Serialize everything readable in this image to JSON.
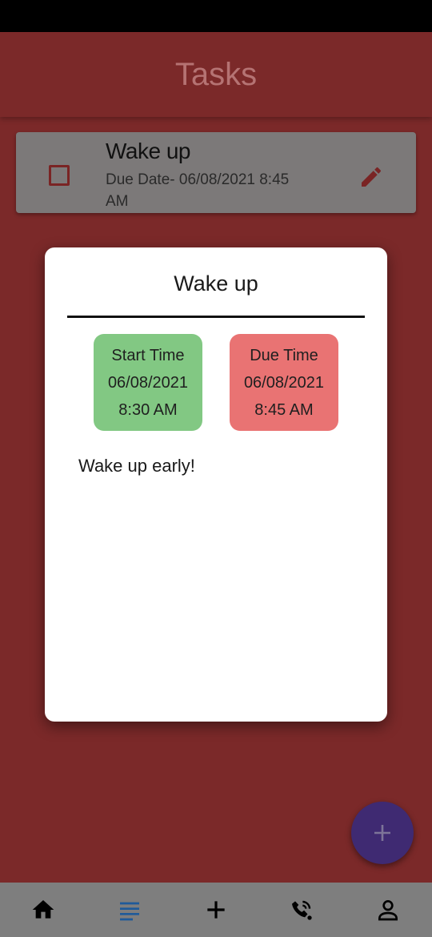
{
  "header": {
    "title": "Tasks"
  },
  "task_list": [
    {
      "title": "Wake up",
      "due_text": "Due Date- 06/08/2021 8:45 AM",
      "checked": false
    }
  ],
  "modal": {
    "title": "Wake up",
    "start": {
      "label": "Start Time",
      "date": "06/08/2021",
      "time": "8:30 AM"
    },
    "due": {
      "label": "Due Time",
      "date": "06/08/2021",
      "time": "8:45 AM"
    },
    "notes": "Wake up early!"
  },
  "fab": {
    "icon": "plus-icon"
  },
  "bottom_nav": {
    "items": [
      {
        "icon": "home-icon",
        "active": false
      },
      {
        "icon": "list-icon",
        "active": true
      },
      {
        "icon": "plus-icon",
        "active": false
      },
      {
        "icon": "phone-call-icon",
        "active": false
      },
      {
        "icon": "person-icon",
        "active": false
      }
    ]
  },
  "colors": {
    "background": "#7b2929",
    "card_overlay": "#7c7979",
    "start_box": "#82c883",
    "due_box": "#e97373",
    "fab": "#3f2a72",
    "nav_active": "#1e5a9a",
    "nav_bg": "#7e7e7e"
  }
}
